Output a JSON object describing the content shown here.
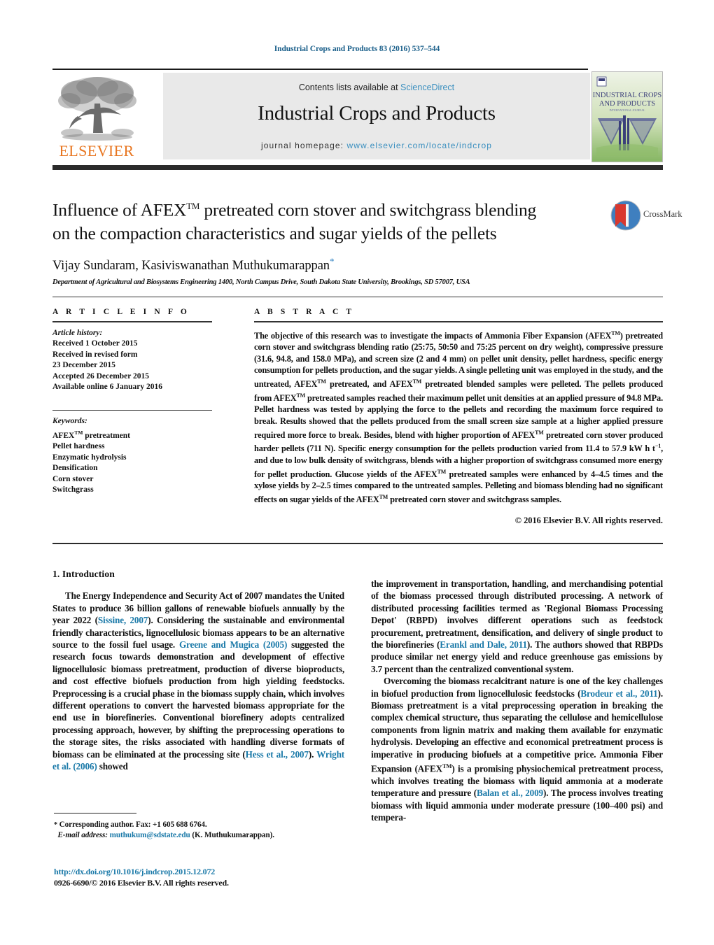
{
  "running_head": "Industrial Crops and Products 83 (2016) 537–544",
  "masthead": {
    "contents_prefix": "Contents lists available at ",
    "sciencedirect": "ScienceDirect",
    "journal_title": "Industrial Crops and Products",
    "homepage_prefix": "journal homepage: ",
    "homepage_url": "www.elsevier.com/locate/indcrop",
    "publisher": "ELSEVIER",
    "cover_line1": "INDUSTRIAL CROPS",
    "cover_line2": "AND PRODUCTS",
    "accent_orange": "#E87722",
    "link_blue": "#3a8fbf"
  },
  "article": {
    "title_line1_a": "Influence of AFEX",
    "title_line1_sup": "TM",
    "title_line1_b": " pretreated corn stover and switchgrass blending",
    "title_line2": "on the compaction characteristics and sugar yields of the pellets",
    "authors": "Vijay Sundaram, Kasiviswanathan Muthukumarappan",
    "author_star": "*",
    "affiliation": "Department of Agricultural and Biosystems Engineering 1400, North Campus Drive, South Dakota State University, Brookings, SD 57007, USA",
    "crossmark_label": "CrossMark"
  },
  "info": {
    "heading": "A R T I C L E   I N F O",
    "history_label": "Article history:",
    "history": [
      "Received 1 October 2015",
      "Received in revised form",
      "23 December 2015",
      "Accepted 26 December 2015",
      "Available online 6 January 2016"
    ],
    "keywords_label": "Keywords:",
    "keywords": [
      "AFEX pretreatment",
      "Pellet hardness",
      "Enzymatic hydrolysis",
      "Densification",
      "Corn stover",
      "Switchgrass"
    ],
    "keyword_first_sup": "TM"
  },
  "abstract": {
    "heading": "A B S T R A C T",
    "p1_a": "The objective of this research was to investigate the impacts of Ammonia Fiber Expansion (AFEX",
    "p1_sup1": "TM",
    "p1_b": ") pretreated corn stover and switchgrass blending ratio (25:75, 50:50 and 75:25 percent on dry weight), compressive pressure (31.6, 94.8, and 158.0 MPa), and screen size (2 and 4 mm) on pellet unit density, pellet hardness, specific energy consumption for pellets production, and the sugar yields. A single pelleting unit was employed in the study, and the untreated, AFEX",
    "p1_sup2": "TM",
    "p1_c": " pretreated, and AFEX",
    "p1_sup3": "TM",
    "p1_d": " pretreated blended samples were pelleted. The pellets produced from AFEX",
    "p1_sup4": "TM",
    "p1_e": " pretreated samples reached their maximum pellet unit densities at an applied pressure of 94.8 MPa. Pellet hardness was tested by applying the force to the pellets and recording the maximum force required to break. Results showed that the pellets produced from the small screen size sample at a higher applied pressure required more force to break. Besides, blend with higher proportion of AFEX",
    "p1_sup5": "TM",
    "p1_f": " pretreated corn stover produced harder pellets (711 N). Specific energy consumption for the pellets production varied from 11.4 to 57.9 kW h t",
    "p1_sup6": "−1",
    "p1_g": ", and due to low bulk density of switchgrass, blends with a higher proportion of switchgrass consumed more energy for pellet production. Glucose yields of the AFEX",
    "p1_sup7": "TM",
    "p1_h": " pretreated samples were enhanced by 4–4.5 times and the xylose yields by 2–2.5 times compared to the untreated samples. Pelleting and biomass blending had no significant effects on sugar yields of the AFEX",
    "p1_sup8": "TM",
    "p1_i": " pretreated corn stover and switchgrass samples.",
    "copyright": "© 2016 Elsevier B.V. All rights reserved."
  },
  "introduction": {
    "heading": "1.  Introduction",
    "left_p1_a": "The Energy Independence and Security Act of 2007 mandates the United States to produce 36 billion gallons of renewable biofuels annually by the year 2022 (",
    "left_cite1": "Sissine, 2007",
    "left_p1_b": "). Considering the sustainable and environmental friendly characteristics, lignocellulosic biomass appears to be an alternative source to the fossil fuel usage. ",
    "left_cite2": "Greene and Mugica (2005)",
    "left_p1_c": " suggested the research focus towards demonstration and development of effective lignocellulosic biomass pretreatment, production of diverse bioproducts, and cost effective biofuels production from high yielding feedstocks. Preprocessing is a crucial phase in the biomass supply chain, which involves different operations to convert the harvested biomass appropriate for the end use in biorefineries. Conventional biorefinery adopts centralized processing approach, however, by shifting the preprocessing operations to the storage sites, the risks associated with handling diverse formats of biomass can be eliminated at the processing site (",
    "left_cite3": "Hess et al., 2007",
    "left_p1_d": "). ",
    "left_cite4": "Wright et al. (2006)",
    "left_p1_e": " showed",
    "right_p1_a": "the improvement in transportation, handling, and merchandising potential of the biomass processed through distributed processing. A network of distributed processing facilities termed as 'Regional Biomass Processing Depot' (RBPD) involves different operations such as feedstock procurement, pretreatment, densification, and delivery of single product to the biorefineries (",
    "right_cite1": "Erankl and Dale, 2011",
    "right_p1_b": "). The authors showed that RBPDs produce similar net energy yield and reduce greenhouse gas emissions by 3.7 percent than the centralized conventional system.",
    "right_p2_a": "Overcoming the biomass recalcitrant nature is one of the key challenges in biofuel production from lignocellulosic feedstocks (",
    "right_cite2": "Brodeur et al., 2011",
    "right_p2_b": "). Biomass pretreatment is a vital preprocessing operation in breaking the complex chemical structure, thus separating the cellulose and hemicellulose components from lignin matrix and making them available for enzymatic hydrolysis. Developing an effective and economical pretreatment process is imperative in producing biofuels at a competitive price. Ammonia Fiber Expansion (AFEX",
    "right_p2_sup": "TM",
    "right_p2_c": ") is a promising physiochemical pretreatment process, which involves treating the biomass with liquid ammonia at a moderate temperature and pressure (",
    "right_cite3": "Balan et al., 2009",
    "right_p2_d": "). The process involves treating biomass with liquid ammonia under moderate pressure (100–400 psi) and tempera-"
  },
  "footer": {
    "star": "*",
    "corresponding": " Corresponding author. Fax: +1 605 688 6764.",
    "email_label": "E-mail address:",
    "email": "muthukum@sdstate.edu",
    "email_suffix": " (K. Muthukumarappan).",
    "doi": "http://dx.doi.org/10.1016/j.indcrop.2015.12.072",
    "issn": "0926-6690/© 2016 Elsevier B.V. All rights reserved."
  }
}
